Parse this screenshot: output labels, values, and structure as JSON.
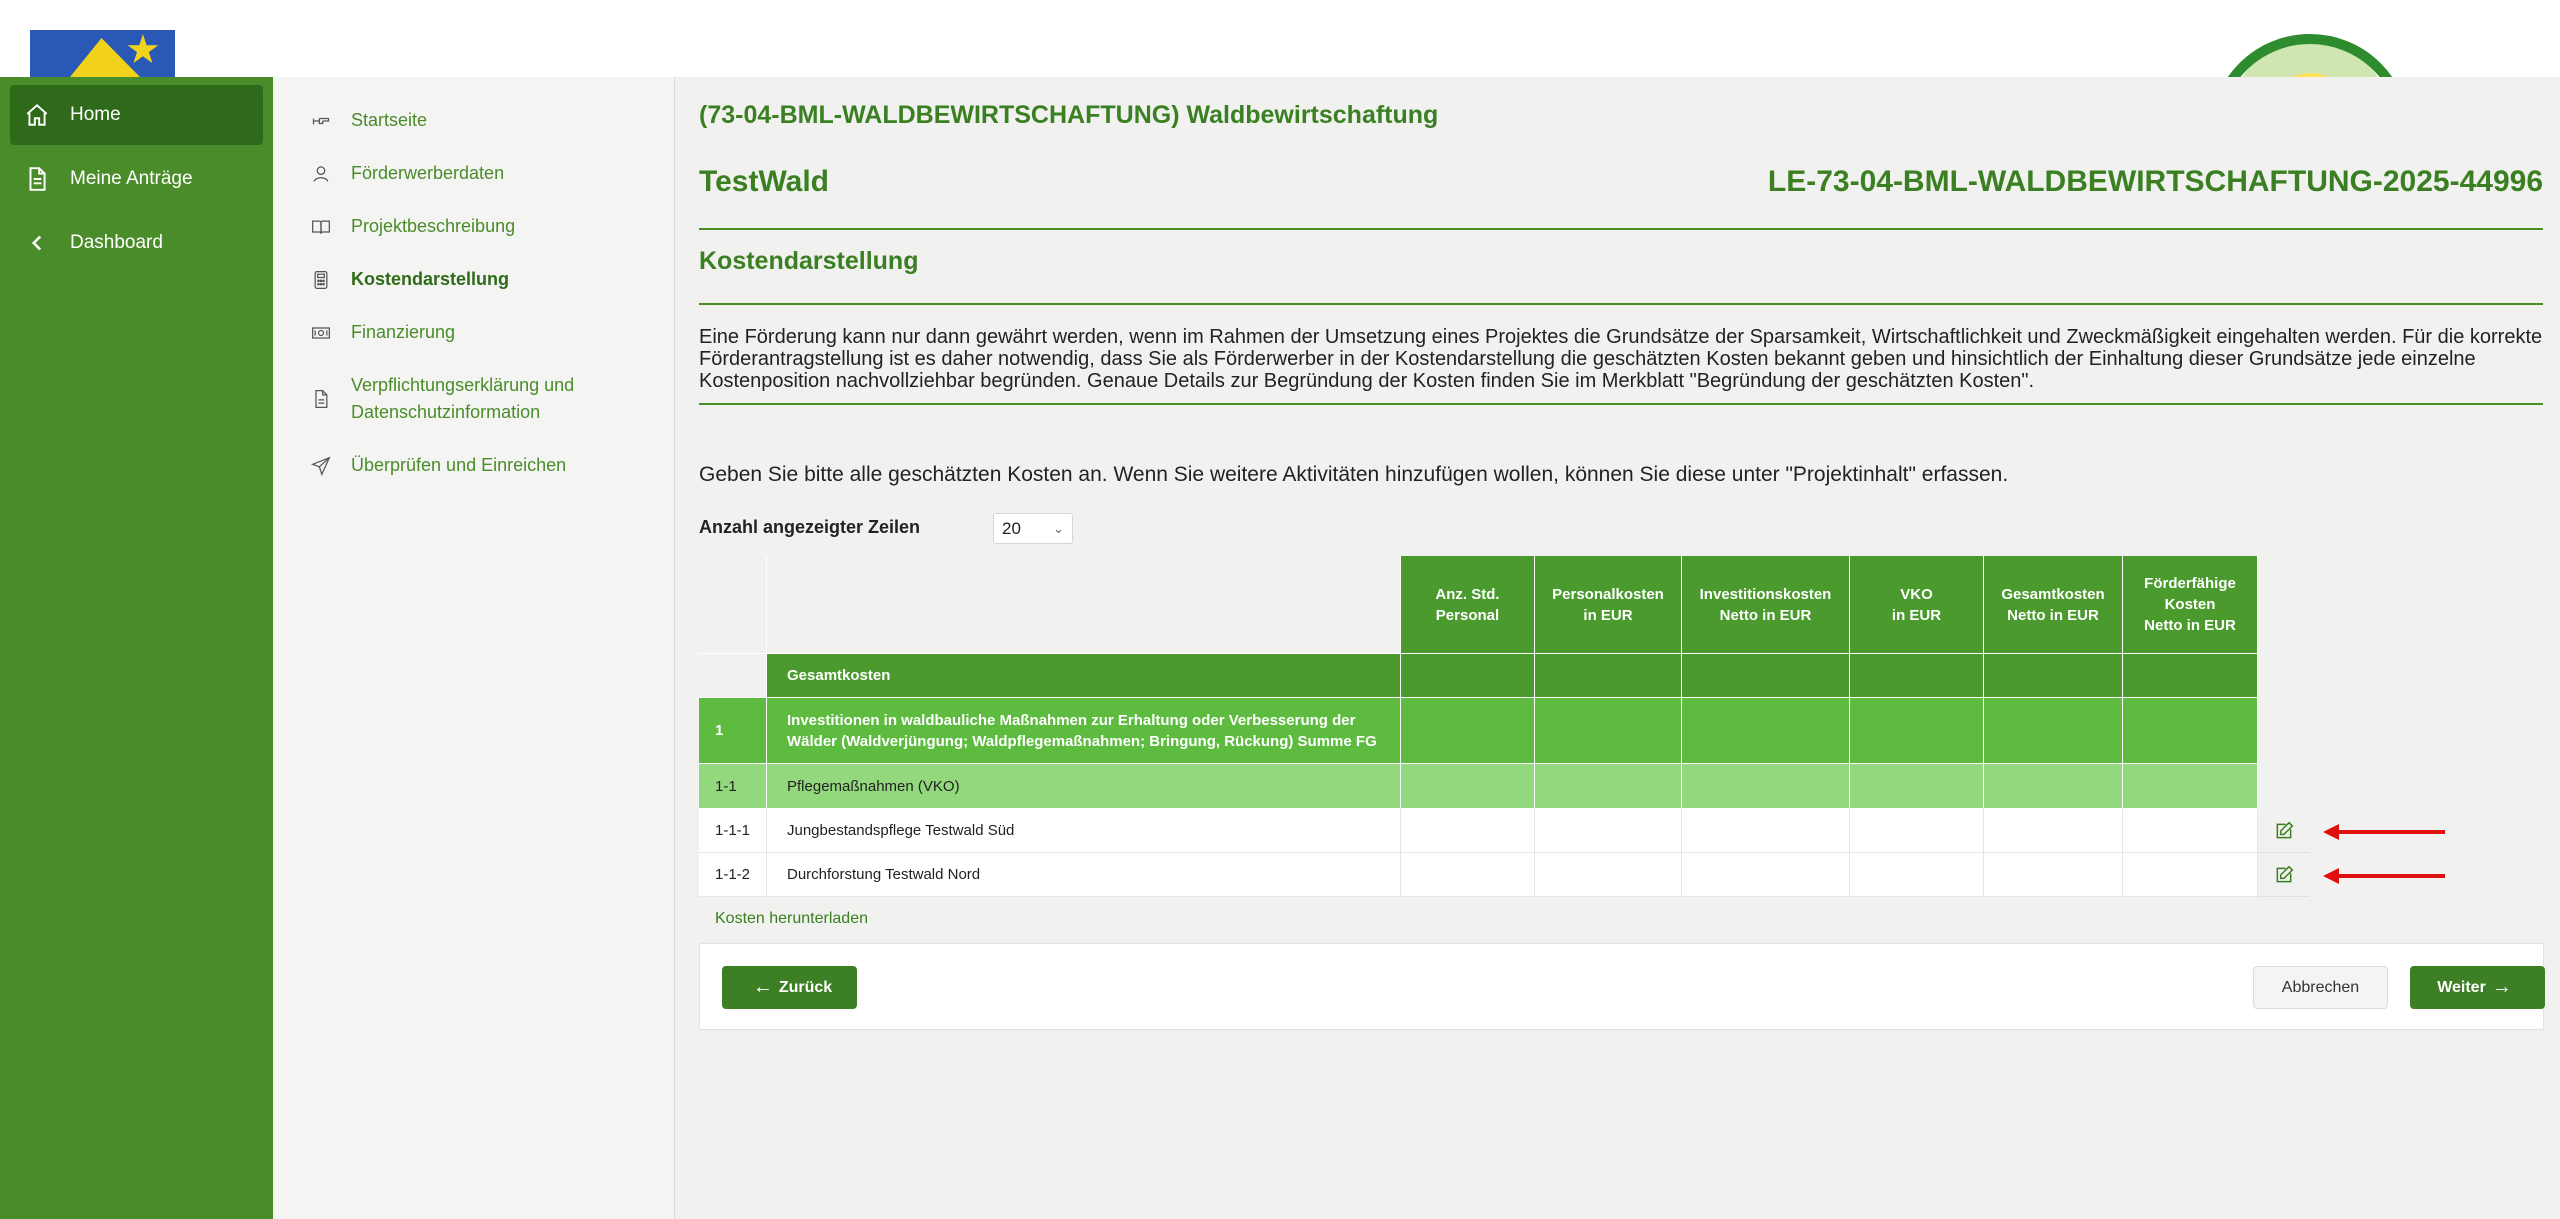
{
  "nav": {
    "items": [
      {
        "label": "Home",
        "icon": "home-icon"
      },
      {
        "label": "Meine Anträge",
        "icon": "document-icon"
      },
      {
        "label": "Dashboard",
        "icon": "chevron-left-icon"
      }
    ]
  },
  "subnav": {
    "items": [
      {
        "label": "Startseite",
        "icon": "pointer-hand-icon"
      },
      {
        "label": "Förderwerberdaten",
        "icon": "person-icon"
      },
      {
        "label": "Projektbeschreibung",
        "icon": "book-icon"
      },
      {
        "label": "Kostendarstellung",
        "icon": "calculator-icon"
      },
      {
        "label": "Finanzierung",
        "icon": "banknote-icon"
      },
      {
        "label": "Verpflichtungserklärung und Datenschutzinformation",
        "icon": "file-icon"
      },
      {
        "label": "Überprüfen und Einreichen",
        "icon": "send-icon"
      }
    ]
  },
  "main": {
    "project_title": "(73-04-BML-WALDBEWIRTSCHAFTUNG) Waldbewirtschaftung",
    "name": "TestWald",
    "reference": "LE-73-04-BML-WALDBEWIRTSCHAFTUNG-2025-44996",
    "section_title": "Kostendarstellung",
    "intro": "Eine Förderung kann nur dann gewährt werden, wenn im Rahmen der Umsetzung eines Projektes die Grundsätze der Sparsamkeit, Wirtschaftlichkeit und Zweckmäßigkeit eingehalten werden. Für die korrekte Förderantragstellung ist es daher notwendig, dass Sie als Förderwerber in der Kostendarstellung die geschätzten Kosten bekannt geben und hinsichtlich der Einhaltung dieser Grundsätze jede einzelne Kostenposition nachvollziehbar begründen. Genaue Details zur Begründung der Kosten finden Sie im Merkblatt \"Begründung der geschätzten Kosten\".",
    "hint": "Geben Sie bitte alle geschätzten Kosten an. Wenn Sie weitere Aktivitäten hinzufügen wollen, können Sie diese unter \"Projektinhalt\" erfassen.",
    "rows_label": "Anzahl angezeigter Zeilen",
    "rows_value": "20",
    "download_link": "Kosten herunterladen"
  },
  "table": {
    "headers": [
      "Anz. Std.\nPersonal",
      "Personalkosten\nin EUR",
      "Investitionskosten\nNetto in EUR",
      "VKO\nin EUR",
      "Gesamtkosten\nNetto in EUR",
      "Förderfähige\nKosten\nNetto in EUR"
    ],
    "gesamt_label": "Gesamtkosten",
    "rows": [
      {
        "num": "1",
        "desc": "Investitionen in waldbauliche Maßnahmen zur Erhaltung oder Verbesserung der Wälder (Waldverjüngung; Waldpflegemaßnahmen; Bringung, Rückung)   Summe FG"
      },
      {
        "num": "1-1",
        "desc": "Pflegemaßnahmen (VKO)"
      },
      {
        "num": "1-1-1",
        "desc": "Jungbestandspflege Testwald Süd"
      },
      {
        "num": "1-1-2",
        "desc": "Durchforstung Testwald Nord"
      }
    ]
  },
  "buttons": {
    "back": "Zurück",
    "cancel": "Abbrechen",
    "next": "Weiter"
  },
  "colors": {
    "primary_green": "#4a8c2a",
    "header_green": "#4a9a2e",
    "row_green": "#5dbb3f",
    "light_green": "#93d87c",
    "annotation_red": "#e01010"
  }
}
